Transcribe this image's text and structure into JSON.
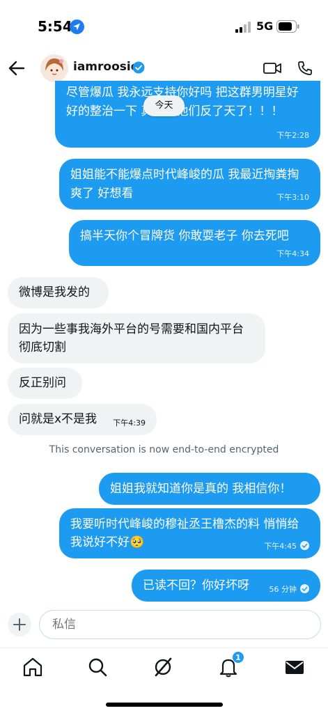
{
  "status_bar": {
    "time": "5:54",
    "network": "5G"
  },
  "header": {
    "contact_name": "iamroosie"
  },
  "date_divider": "今天",
  "messages": [
    {
      "text": "尽管爆瓜 我永远支持你好吗 把这群男明星好好的整治一下 真是让他们反了天了！！！",
      "time": "下午2:28"
    },
    {
      "text": "姐姐能不能爆点时代峰峻的瓜 我最近掏粪掏爽了 好想看",
      "time": "下午3:10"
    },
    {
      "text": "搞半天你个冒牌货 你敢耍老子 你去死吧",
      "time": "下午4:34"
    },
    {
      "text": "微博是我发的"
    },
    {
      "text": "因为一些事我海外平台的号需要和国内平台彻底切割"
    },
    {
      "text": "反正别问"
    },
    {
      "text": "问就是x不是我",
      "time": "下午4:39"
    },
    {
      "text": "姐姐我就知道你是真的 我相信你！"
    },
    {
      "text": "我要听时代峰峻的穆祉丞王橹杰的料 悄悄给我说好不好🥺",
      "time": "下午4:45"
    },
    {
      "text": "已读不回？你好坏呀",
      "time": "56 分钟"
    }
  ],
  "system_note": "This conversation is now end-to-end encrypted",
  "composer": {
    "placeholder": "私信"
  },
  "tabbar": {
    "notifications_badge": "1"
  },
  "colors": {
    "accent": "#1d9bf0",
    "incoming_bubble": "#eff3f4"
  }
}
